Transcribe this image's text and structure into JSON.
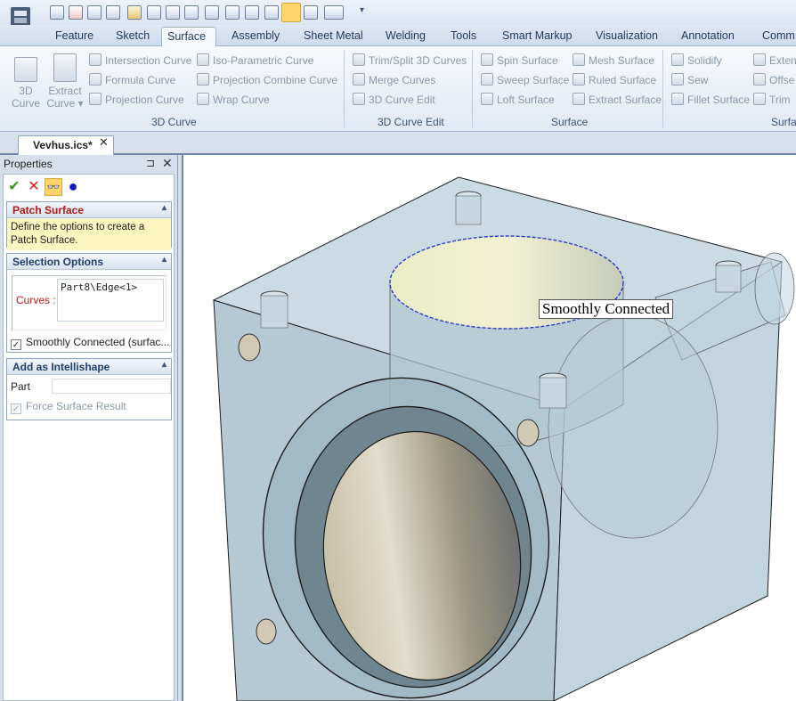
{
  "quick_access": {
    "icons": [
      "app-logo-icon",
      "new-file-icon",
      "new-drawing-icon",
      "new-doc-icon",
      "new-template-icon",
      "open-folder-icon",
      "save-icon",
      "save-all-icon",
      "print-icon",
      "import-icon",
      "undo-icon",
      "redo-icon",
      "catalog-icon",
      "intellishape-icon",
      "properties-icon",
      "view-options-icon",
      "customize-dropdown-icon"
    ]
  },
  "tabs": [
    "Feature",
    "Sketch",
    "Surface",
    "Assembly",
    "Sheet Metal",
    "Welding",
    "Tools",
    "Smart Markup",
    "Visualization",
    "Annotation",
    "Comm"
  ],
  "active_tab": "Surface",
  "ribbon": {
    "curve3d": {
      "label": "3D Curve",
      "big_3d_line1": "3D",
      "big_3d_line2": "Curve",
      "big_extract_line1": "Extract",
      "big_extract_line2": "Curve ▾",
      "intersection": "Intersection Curve",
      "formula": "Formula Curve",
      "projection": "Projection Curve",
      "isoparam": "Iso-Parametric Curve",
      "projcombine": "Projection Combine Curve",
      "wrap": "Wrap Curve"
    },
    "edit3d": {
      "label": "3D Curve Edit",
      "trim": "Trim/Split 3D Curves",
      "merge": "Merge Curves",
      "edit": "3D Curve Edit"
    },
    "surface": {
      "label": "Surface",
      "spin": "Spin Surface",
      "sweep": "Sweep Surface",
      "loft": "Loft Surface",
      "mesh": "Mesh Surface",
      "ruled": "Ruled Surface",
      "extract": "Extract Surface"
    },
    "surf2": {
      "label": "Surfa",
      "solidify": "Solidify",
      "sew": "Sew",
      "fillet": "Fillet Surface",
      "extend": "Exten",
      "offset": "Offse",
      "trim": "Trim"
    }
  },
  "document": {
    "tab_title": "Vevhus.ics*",
    "close_glyph": "✕"
  },
  "properties": {
    "title": "Properties",
    "pin_glyph": "⊐",
    "close_glyph": "✕",
    "ok_glyph": "✔",
    "cancel_glyph": "✕",
    "preview_glyph": "👓",
    "apply_glyph": "●",
    "patch": {
      "header": "Patch Surface",
      "caret": "▴",
      "description": "Define the options to create a Patch Surface."
    },
    "selection": {
      "header": "Selection Options",
      "caret": "▴",
      "curves_label": "Curves :",
      "curves_value": "Part8\\Edge<1>",
      "smooth_label": "Smoothly Connected (surfac...",
      "smooth_checked": true
    },
    "intellishape": {
      "header": "Add as Intellishape",
      "caret": "▴",
      "part_label": "Part",
      "part_value": "",
      "force_label": "Force Surface Result",
      "force_checked": true
    }
  },
  "viewport": {
    "overlay_label": "Smoothly Connected"
  },
  "colors": {
    "accent": "#1f3f6b",
    "selection_dash": "#2a3bc8",
    "body_tint": "#b7cdd8"
  }
}
